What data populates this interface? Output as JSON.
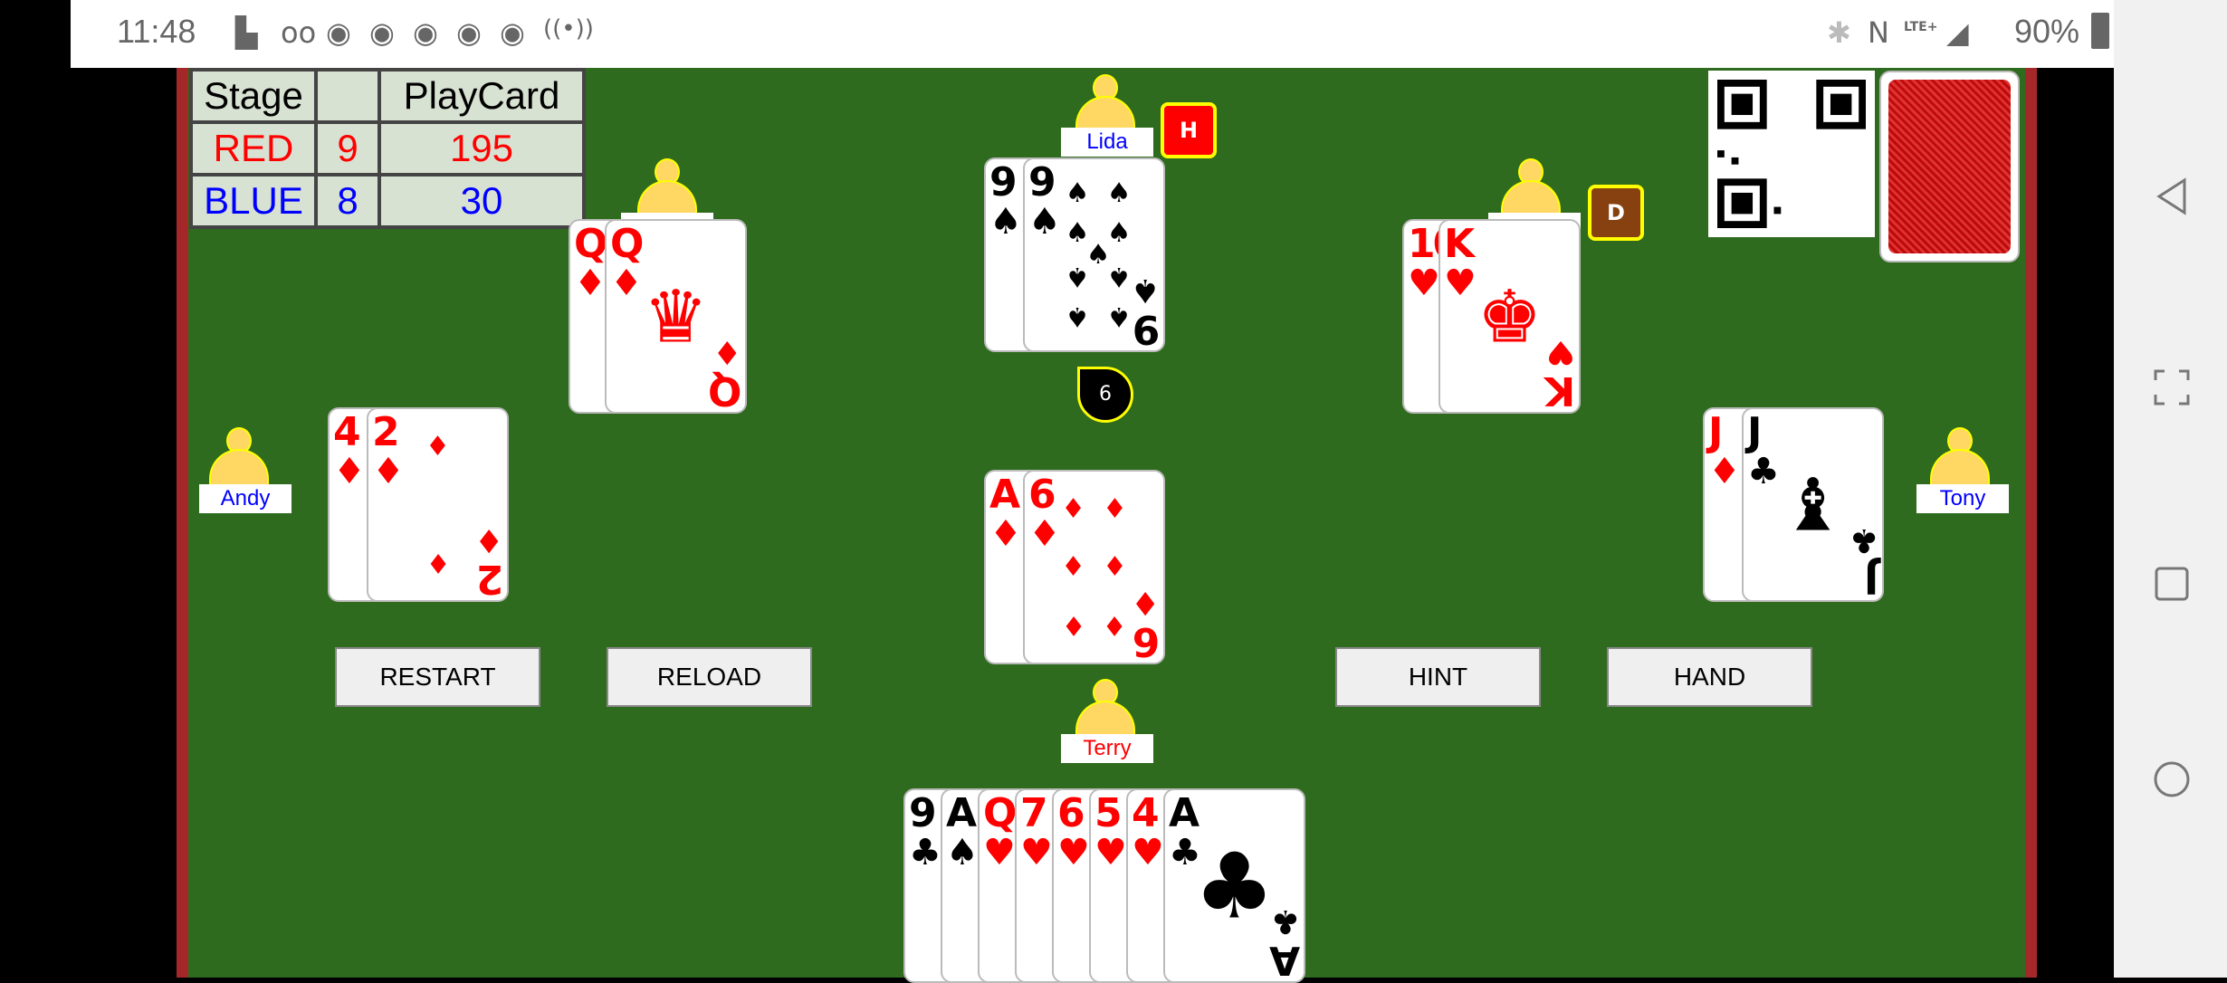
{
  "status_bar": {
    "time": "11:48",
    "battery": "90%",
    "network": "LTE+",
    "icons": [
      "video-call-icon",
      "voicemail-icon",
      "chrome-icon",
      "chrome-icon",
      "chrome-icon",
      "chrome-icon",
      "chrome-icon",
      "hotspot-icon",
      "bluetooth-icon",
      "nfc-icon",
      "lte-icon",
      "signal-icon",
      "battery-icon"
    ]
  },
  "score": {
    "headers": [
      "Stage",
      "",
      "PlayCard"
    ],
    "rows": [
      {
        "team": "RED",
        "stage": "9",
        "points": "195"
      },
      {
        "team": "BLUE",
        "stage": "8",
        "points": "30"
      }
    ],
    "colors": {
      "red": "#ff0000",
      "blue": "#0000ff"
    }
  },
  "players": {
    "north": "Lida",
    "west": "Andy",
    "east": "Tony",
    "south": "Terry"
  },
  "badges": {
    "north": "H",
    "northeast": "D"
  },
  "trick_counter": "6",
  "cards": {
    "northwest": [
      {
        "rank": "Q",
        "suit": "♦"
      },
      {
        "rank": "Q",
        "suit": "♦"
      }
    ],
    "north": [
      {
        "rank": "9",
        "suit": "♠"
      },
      {
        "rank": "9",
        "suit": "♠"
      }
    ],
    "northeast": [
      {
        "rank": "10",
        "suit": "♥"
      },
      {
        "rank": "K",
        "suit": "♥"
      }
    ],
    "west": [
      {
        "rank": "4",
        "suit": "♦"
      },
      {
        "rank": "2",
        "suit": "♦"
      }
    ],
    "east": [
      {
        "rank": "J",
        "suit": "♦"
      },
      {
        "rank": "J",
        "suit": "♣"
      }
    ],
    "center": [
      {
        "rank": "A",
        "suit": "♦"
      },
      {
        "rank": "6",
        "suit": "♦"
      }
    ],
    "hand": [
      {
        "rank": "9",
        "suit": "♣"
      },
      {
        "rank": "A",
        "suit": "♠"
      },
      {
        "rank": "Q",
        "suit": "♥"
      },
      {
        "rank": "7",
        "suit": "♥"
      },
      {
        "rank": "6",
        "suit": "♥"
      },
      {
        "rank": "5",
        "suit": "♥"
      },
      {
        "rank": "4",
        "suit": "♥"
      },
      {
        "rank": "A",
        "suit": "♣"
      }
    ]
  },
  "buttons": {
    "restart": "RESTART",
    "reload": "RELOAD",
    "hint": "HINT",
    "hand": "HAND"
  }
}
